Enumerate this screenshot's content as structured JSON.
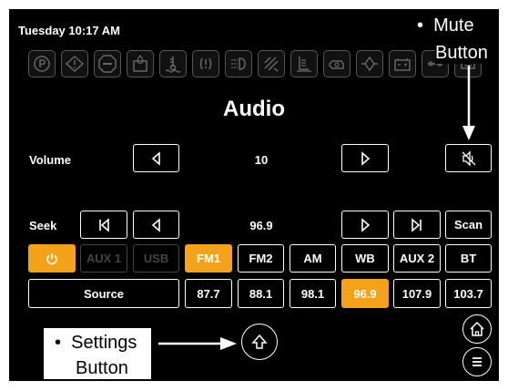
{
  "status": {
    "time": "Tuesday 10:17 AM"
  },
  "warning_icons": [
    "parking-brake-icon",
    "warning-triangle-icon",
    "stop-icon",
    "fuel-water-icon",
    "coolant-temp-icon",
    "fault-light-icon",
    "headlight-icon",
    "tow-icon",
    "engine-oil-icon",
    "engine-icon",
    "filter-icon",
    "battery-icon"
  ],
  "page": {
    "title": "Audio"
  },
  "volume": {
    "label": "Volume",
    "value": "10"
  },
  "seek": {
    "label": "Seek",
    "value": "96.9",
    "scan_label": "Scan"
  },
  "sources": [
    {
      "label": "AUX 1",
      "state": "disabled"
    },
    {
      "label": "USB",
      "state": "disabled"
    },
    {
      "label": "FM1",
      "state": "active"
    },
    {
      "label": "FM2",
      "state": "normal"
    },
    {
      "label": "AM",
      "state": "normal"
    },
    {
      "label": "WB",
      "state": "normal"
    },
    {
      "label": "AUX 2",
      "state": "normal"
    },
    {
      "label": "BT",
      "state": "normal"
    }
  ],
  "source_button": {
    "label": "Source"
  },
  "presets": [
    {
      "label": "87.7",
      "state": "normal"
    },
    {
      "label": "88.1",
      "state": "normal"
    },
    {
      "label": "98.1",
      "state": "normal"
    },
    {
      "label": "96.9",
      "state": "active"
    },
    {
      "label": "107.9",
      "state": "normal"
    },
    {
      "label": "103.7",
      "state": "normal"
    }
  ],
  "callouts": {
    "mute_line1": "Mute",
    "mute_line2": "Button",
    "settings_line1": "Settings",
    "settings_line2": "Button"
  },
  "colors": {
    "accent": "#f5a21b",
    "background": "#000000",
    "text": "#ffffff"
  }
}
